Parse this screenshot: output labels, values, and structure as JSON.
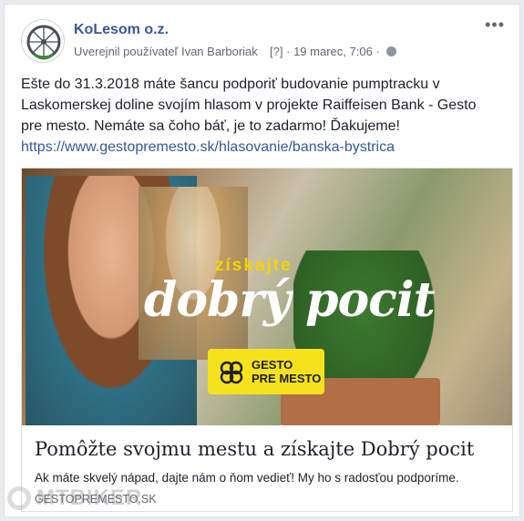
{
  "post": {
    "page_name": "KoLesom o.z.",
    "meta": {
      "published_by": "Uverejnil používateľ Ivan Barboriak",
      "question": "[?]",
      "date": "19 marec, 7:06"
    },
    "more_icon": "more-horizontal-icon",
    "text_line1": "Ešte do 31.3.2018 máte šancu podporiť budovanie pumptracku v",
    "text_line2": "Laskomerskej doline svojím hlasom v projekte Raiffeisen Bank - Gesto",
    "text_line3": "pre mesto. Nemáte sa čoho báť, je to zadarmo! Ďakujeme!",
    "link": "https://www.gestopremesto.sk/hlasovanie/banska-bystrica"
  },
  "attachment": {
    "image_text_small": "získajte",
    "image_text_large": "dobrý pocit",
    "logo_line1": "GESTO",
    "logo_line2": "PRE MESTO",
    "title": "Pomôžte svojmu mestu a získajte Dobrý pocit",
    "description": "Ak máte skvelý nápad, dajte nám o ňom vedieť! My ho s radosťou podporíme.",
    "domain": "GESTOPREMESTO.SK"
  },
  "watermark": {
    "text": "MTBIKER"
  },
  "colors": {
    "link": "#365899",
    "background": "#e9ebee",
    "logo_yellow": "#f6e21c"
  }
}
